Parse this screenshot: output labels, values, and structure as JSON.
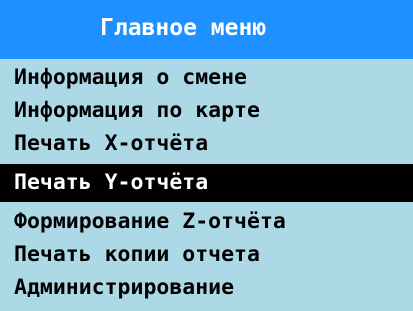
{
  "header": {
    "title": "Главное меню"
  },
  "menu": {
    "items": [
      {
        "label": "Информация о смене",
        "selected": false
      },
      {
        "label": "Информация по карте",
        "selected": false
      },
      {
        "label": "Печать X-отчёта",
        "selected": false
      },
      {
        "label": "Печать Y-отчёта",
        "selected": true
      },
      {
        "label": "Формирование Z-отчёта",
        "selected": false
      },
      {
        "label": "Печать копии отчета",
        "selected": false
      },
      {
        "label": "Администрирование",
        "selected": false
      }
    ]
  },
  "colors": {
    "header_background": "#1e90ff",
    "header_text": "#ffffff",
    "display_background": "#add8e6",
    "item_text": "#000000",
    "selected_background": "#000000",
    "selected_text": "#ffffff"
  }
}
